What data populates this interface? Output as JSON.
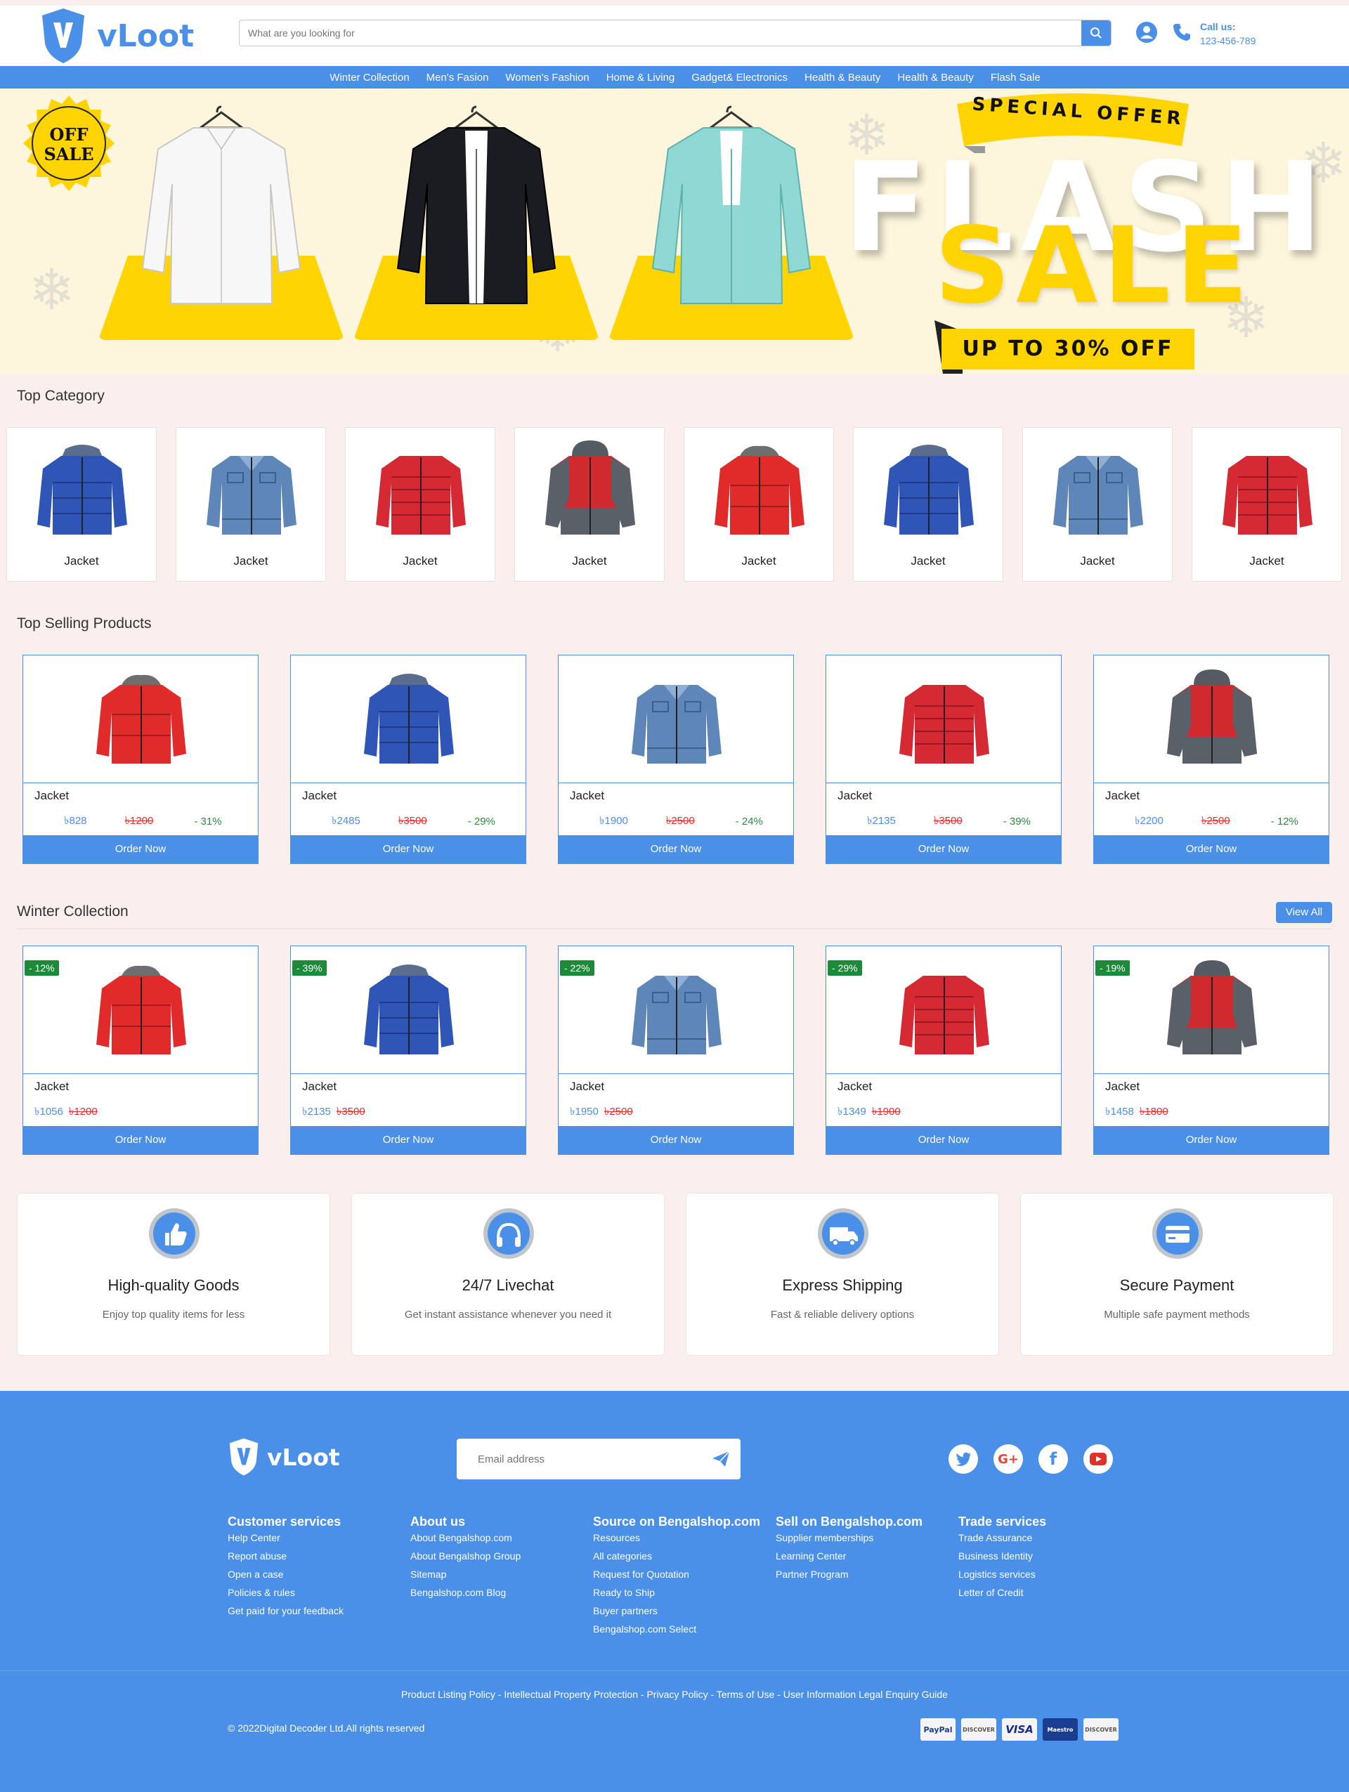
{
  "header": {
    "brand": "vLoot",
    "search_placeholder": "What are you looking for",
    "call_label": "Call us:",
    "phone": "123-456-789"
  },
  "nav": [
    "Winter Collection",
    "Men's Fasion",
    "Women's Fashion",
    "Home & Living",
    "Gadget& Electronics",
    "Health & Beauty",
    "Health & Beauty",
    "Flash Sale"
  ],
  "banner": {
    "badge_line1": "OFF",
    "badge_line2": "SALE",
    "special": "SPECIAL OFFER",
    "flash": "FLASH",
    "sale": "SALE",
    "upto": "UP TO 30% OFF"
  },
  "top_category": {
    "title": "Top Category",
    "items": [
      {
        "label": "Jacket",
        "icon": "blue-puffer-jacket"
      },
      {
        "label": "Jacket",
        "icon": "denim-jacket"
      },
      {
        "label": "Jacket",
        "icon": "red-puffer-jacket"
      },
      {
        "label": "Jacket",
        "icon": "red-grey-hooded-jacket"
      },
      {
        "label": "Jacket",
        "icon": "red-fur-hood-jacket"
      },
      {
        "label": "Jacket",
        "icon": "blue-puffer-jacket"
      },
      {
        "label": "Jacket",
        "icon": "denim-jacket"
      },
      {
        "label": "Jacket",
        "icon": "red-puffer-jacket"
      }
    ]
  },
  "top_selling": {
    "title": "Top Selling Products",
    "items": [
      {
        "name": "Jacket",
        "price": "৳828",
        "old": "৳1200",
        "off": "- 31%",
        "button": "Order Now",
        "icon": "red-fur-hood-jacket"
      },
      {
        "name": "Jacket",
        "price": "৳2485",
        "old": "৳3500",
        "off": "- 29%",
        "button": "Order Now",
        "icon": "blue-puffer-jacket"
      },
      {
        "name": "Jacket",
        "price": "৳1900",
        "old": "৳2500",
        "off": "- 24%",
        "button": "Order Now",
        "icon": "denim-jacket"
      },
      {
        "name": "Jacket",
        "price": "৳2135",
        "old": "৳3500",
        "off": "- 39%",
        "button": "Order Now",
        "icon": "red-puffer-jacket"
      },
      {
        "name": "Jacket",
        "price": "৳2200",
        "old": "৳2500",
        "off": "- 12%",
        "button": "Order Now",
        "icon": "red-grey-hooded-jacket"
      }
    ]
  },
  "winter": {
    "title": "Winter Collection",
    "view_all": "View All",
    "items": [
      {
        "badge": "- 12%",
        "name": "Jacket",
        "price": "৳1056",
        "old": "৳1200",
        "button": "Order Now",
        "icon": "red-fur-hood-jacket"
      },
      {
        "badge": "- 39%",
        "name": "Jacket",
        "price": "৳2135",
        "old": "৳3500",
        "button": "Order Now",
        "icon": "blue-puffer-jacket"
      },
      {
        "badge": "- 22%",
        "name": "Jacket",
        "price": "৳1950",
        "old": "৳2500",
        "button": "Order Now",
        "icon": "denim-jacket"
      },
      {
        "badge": "- 29%",
        "name": "Jacket",
        "price": "৳1349",
        "old": "৳1900",
        "button": "Order Now",
        "icon": "red-puffer-jacket"
      },
      {
        "badge": "- 19%",
        "name": "Jacket",
        "price": "৳1458",
        "old": "৳1800",
        "button": "Order Now",
        "icon": "red-grey-hooded-jacket"
      }
    ]
  },
  "features": [
    {
      "title": "High-quality Goods",
      "desc": "Enjoy top quality items for less",
      "icon": "thumbs-up-icon"
    },
    {
      "title": "24/7 Livechat",
      "desc": "Get instant assistance whenever you need it",
      "icon": "headphones-icon"
    },
    {
      "title": "Express Shipping",
      "desc": "Fast & reliable delivery options",
      "icon": "truck-icon"
    },
    {
      "title": "Secure Payment",
      "desc": "Multiple safe payment methods",
      "icon": "credit-card-icon"
    }
  ],
  "footer": {
    "brand": "vLoot",
    "email_placeholder": "Email address",
    "columns": [
      {
        "title": "Customer services",
        "links": [
          "Help Center",
          "Report abuse",
          "Open a case",
          "Policies & rules",
          "Get paid for your feedback"
        ]
      },
      {
        "title": "About us",
        "links": [
          "About Bengalshop.com",
          "About Bengalshop Group",
          "Sitemap",
          "Bengalshop.com Blog"
        ]
      },
      {
        "title": "Source on Bengalshop.com",
        "links": [
          "Resources",
          "All categories",
          "Request for Quotation",
          "Ready to Ship",
          "Buyer partners",
          "Bengalshop.com Select"
        ]
      },
      {
        "title": "Sell on Bengalshop.com",
        "links": [
          "Supplier memberships",
          "Learning Center",
          "Partner Program"
        ]
      },
      {
        "title": "Trade services",
        "links": [
          "Trade Assurance",
          "Business Identity",
          "Logistics services",
          "Letter of Credit"
        ]
      }
    ],
    "bottom_links": [
      "Product Listing Policy",
      "Intellectual Property Protection",
      "Privacy Policy",
      "Terms of Use",
      "User Information Legal Enquiry Guide"
    ],
    "copyright": "© 2022Digital Decoder Ltd.All rights reserved",
    "payments": [
      "PayPal",
      "DISCOVER",
      "VISA",
      "Maestro",
      "DISCOVER"
    ]
  },
  "colors": {
    "primary": "#4a8fe8",
    "page_bg": "#fbefee",
    "sale_yellow": "#ffd400",
    "badge_green": "#1d8a3a",
    "old_price_red": "#e2302d"
  }
}
